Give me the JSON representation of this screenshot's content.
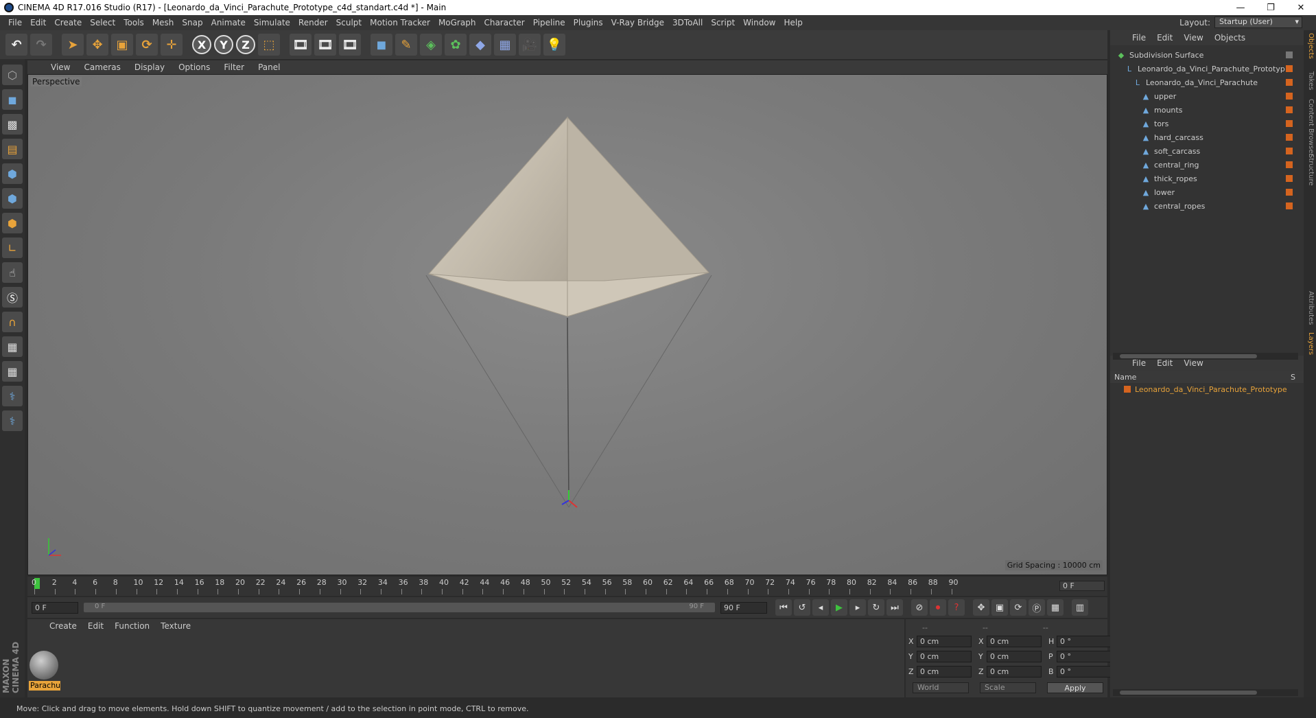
{
  "window": {
    "title": "CINEMA 4D R17.016 Studio (R17) - [Leonardo_da_Vinci_Parachute_Prototype_c4d_standart.c4d *] - Main",
    "minimize": "—",
    "maximize": "❐",
    "close": "✕"
  },
  "menu": [
    "File",
    "Edit",
    "Create",
    "Select",
    "Tools",
    "Mesh",
    "Snap",
    "Animate",
    "Simulate",
    "Render",
    "Sculpt",
    "Motion Tracker",
    "MoGraph",
    "Character",
    "Pipeline",
    "Plugins",
    "V-Ray Bridge",
    "3DToAll",
    "Script",
    "Window",
    "Help"
  ],
  "layout": {
    "label": "Layout:",
    "value": "Startup (User)"
  },
  "viewport": {
    "menu": [
      "View",
      "Cameras",
      "Display",
      "Options",
      "Filter",
      "Panel"
    ],
    "label": "Perspective",
    "grid_spacing": "Grid Spacing : 10000 cm"
  },
  "timeline": {
    "ticks": [
      "0",
      "2",
      "4",
      "6",
      "8",
      "10",
      "12",
      "14",
      "16",
      "18",
      "20",
      "22",
      "24",
      "26",
      "28",
      "30",
      "32",
      "34",
      "36",
      "38",
      "40",
      "42",
      "44",
      "46",
      "48",
      "50",
      "52",
      "54",
      "56",
      "58",
      "60",
      "62",
      "64",
      "66",
      "68",
      "70",
      "72",
      "74",
      "76",
      "78",
      "80",
      "82",
      "84",
      "86",
      "88",
      "90"
    ],
    "current": "0 F"
  },
  "playbar": {
    "start": "0 F",
    "range_start": "0 F",
    "range_end": "90 F",
    "end": "90 F"
  },
  "material": {
    "menu": [
      "Create",
      "Edit",
      "Function",
      "Texture"
    ],
    "name": "Parachu"
  },
  "coords": {
    "header": [
      "--",
      "--",
      "--"
    ],
    "rows": [
      {
        "a": "X",
        "av": "0 cm",
        "b": "X",
        "bv": "0 cm",
        "c": "H",
        "cv": "0 °"
      },
      {
        "a": "Y",
        "av": "0 cm",
        "b": "Y",
        "bv": "0 cm",
        "c": "P",
        "cv": "0 °"
      },
      {
        "a": "Z",
        "av": "0 cm",
        "b": "Z",
        "bv": "0 cm",
        "c": "B",
        "cv": "0 °"
      }
    ],
    "mode": "World",
    "scale": "Scale",
    "apply": "Apply"
  },
  "objects": {
    "menu": [
      "File",
      "Edit",
      "View",
      "Objects"
    ],
    "items": [
      {
        "label": "Subdivision Surface",
        "indent": 0,
        "icon": "◆"
      },
      {
        "label": "Leonardo_da_Vinci_Parachute_Prototyp",
        "indent": 1,
        "icon": "L"
      },
      {
        "label": "Leonardo_da_Vinci_Parachute",
        "indent": 2,
        "icon": "L"
      },
      {
        "label": "upper",
        "indent": 3,
        "icon": "▲"
      },
      {
        "label": "mounts",
        "indent": 3,
        "icon": "▲"
      },
      {
        "label": "tors",
        "indent": 3,
        "icon": "▲"
      },
      {
        "label": "hard_carcass",
        "indent": 3,
        "icon": "▲"
      },
      {
        "label": "soft_carcass",
        "indent": 3,
        "icon": "▲"
      },
      {
        "label": "central_ring",
        "indent": 3,
        "icon": "▲"
      },
      {
        "label": "thick_ropes",
        "indent": 3,
        "icon": "▲"
      },
      {
        "label": "lower",
        "indent": 3,
        "icon": "▲"
      },
      {
        "label": "central_ropes",
        "indent": 3,
        "icon": "▲"
      }
    ]
  },
  "layers": {
    "menu": [
      "File",
      "Edit",
      "View"
    ],
    "header_name": "Name",
    "header_s": "S",
    "item": "Leonardo_da_Vinci_Parachute_Prototype"
  },
  "sidetabs": [
    "Objects",
    "Takes",
    "Content Browser",
    "Structure",
    "Attributes",
    "Layers"
  ],
  "status": "Move: Click and drag to move elements. Hold down SHIFT to quantize movement / add to the selection in point mode, CTRL to remove.",
  "brand": "MAXON CINEMA 4D",
  "colors": {
    "accent": "#e8a33a",
    "tag": "#d5641f"
  }
}
